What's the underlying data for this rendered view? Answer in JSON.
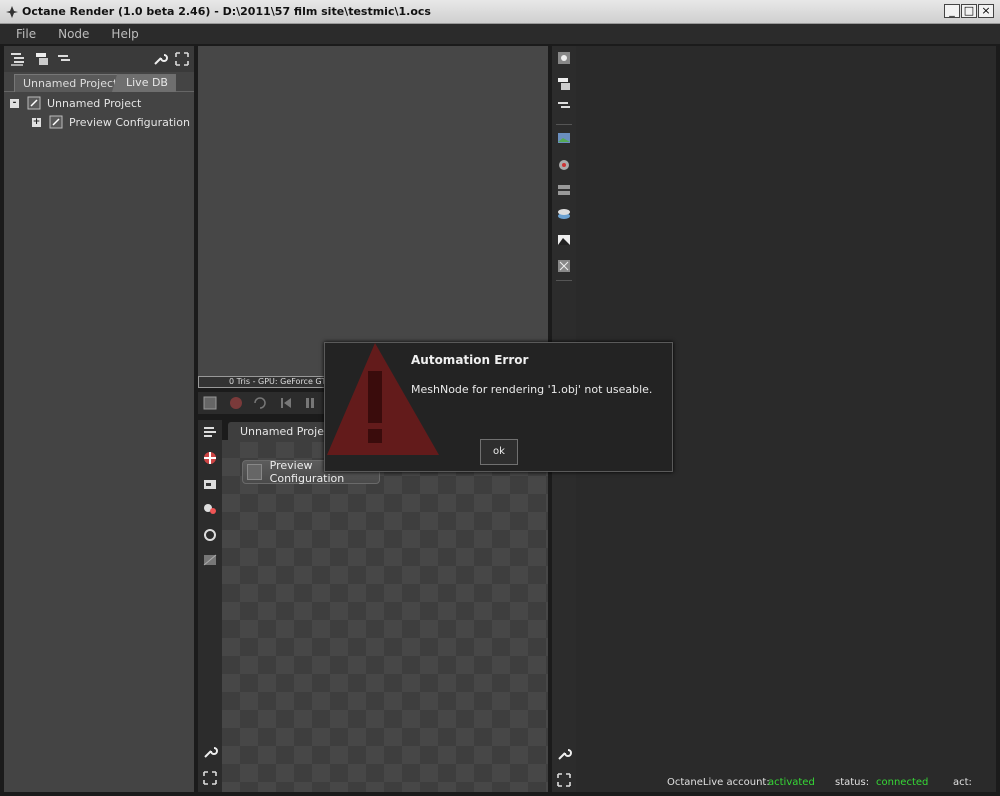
{
  "window": {
    "title": "Octane Render (1.0 beta 2.46) - D:\\2011\\57 film site\\testmic\\1.ocs",
    "controls": [
      "_",
      "□",
      "×"
    ]
  },
  "menubar": {
    "items": [
      "File",
      "Node",
      "Help"
    ]
  },
  "scene_panel": {
    "tabs": [
      "Unnamed Project",
      "Live DB"
    ],
    "tree": [
      {
        "label": "Unnamed Project",
        "expander": "-"
      },
      {
        "label": "Preview Configuration",
        "expander": "+"
      }
    ]
  },
  "viewport": {
    "status_text": "0 Tris - GPU: GeForce GT"
  },
  "node_graph": {
    "tab_label": "Unnamed Project",
    "node_label": "Preview Configuration"
  },
  "statusbar": {
    "account_label": "OctaneLive account:",
    "account_value": "activated",
    "status_label": "status:",
    "status_value": "connected",
    "act_label": "act:"
  },
  "dialog": {
    "title": "Automation Error",
    "message": "MeshNode for rendering '1.obj' not useable.",
    "ok_label": "ok"
  },
  "colors": {
    "status_green": "#36d836",
    "warning_red": "#7a1f1f"
  },
  "icons": [
    "octane-app-icon",
    "tree-view-icon",
    "wrench-icon",
    "expand-icon",
    "render-icon",
    "camera-icon",
    "environment-icon",
    "image-icon",
    "warning-icon"
  ]
}
